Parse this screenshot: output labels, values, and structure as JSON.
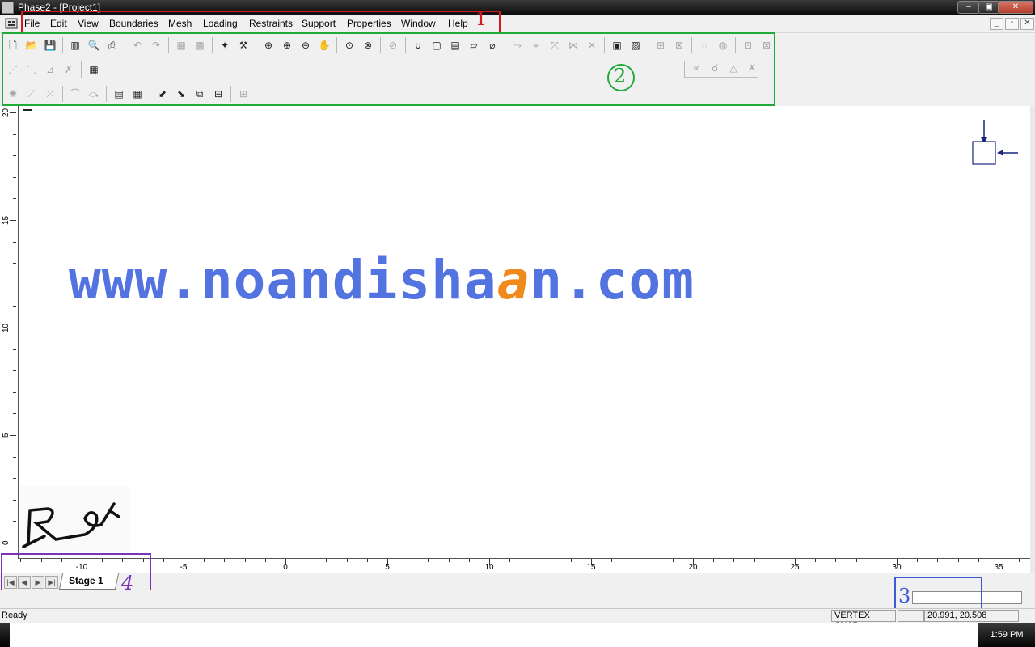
{
  "window": {
    "title": "Phase2 - [Project1]",
    "buttons": {
      "minimize": "–",
      "maximize": "▣",
      "close": "✕"
    }
  },
  "menu": {
    "items": [
      "File",
      "Edit",
      "View",
      "Boundaries",
      "Mesh",
      "Loading",
      "Restraints",
      "Support",
      "Properties",
      "Window",
      "Help"
    ],
    "mdi_buttons": {
      "minimize": "_",
      "restore": "▫",
      "close": "✕"
    }
  },
  "annotations": {
    "menu": "1",
    "toolbars": "2",
    "command_box": "3",
    "stage_tabs": "4"
  },
  "canvas": {
    "y_tick_labels": [
      "20",
      "15",
      "10",
      "5",
      "0"
    ],
    "x_tick_labels": [
      "-10",
      "-5",
      "0",
      "5",
      "10",
      "15",
      "20",
      "25",
      "30",
      "35"
    ],
    "watermark": {
      "before": "www.noandisha",
      "accent": "a",
      "after": "n.com"
    },
    "signature": "R"
  },
  "stages": {
    "nav": [
      "|◀",
      "◀",
      "▶",
      "▶|"
    ],
    "active_tab": "Stage 1"
  },
  "command_input": {
    "value": ""
  },
  "status": {
    "left": "Ready",
    "snap": "VERTEX SNAP",
    "coords": "20.991,  20.508"
  },
  "taskbar": {
    "clock": "1:59 PM"
  },
  "toolbar": {
    "row1": [
      "new-icon",
      "open-icon",
      "save-icon",
      "sep",
      "page-layout-icon",
      "print-preview-icon",
      "print-icon",
      "sep",
      "undo-icon",
      "redo-icon",
      "sep",
      "gray-box-icon",
      "gray-box-icon-2",
      "sep",
      "interpret-icon",
      "tools-icon",
      "sep",
      "zoom-all-icon",
      "zoom-in-icon",
      "zoom-out-icon",
      "pan-icon",
      "sep",
      "zoom-window-icon",
      "zoom-previous-icon",
      "sep",
      "zoom-extents-icon",
      "sep",
      "add-external-icon",
      "add-excavation-icon",
      "add-stage-boundary-icon",
      "add-material-boundary-icon",
      "delete-boundary-icon",
      "sep",
      "node-icon",
      "vertex-icon",
      "merge-icon",
      "mesh-icon",
      "discretize-icon",
      "sep",
      "mesh-setup-icon",
      "mesh-display-icon",
      "sep",
      "load-icon",
      "load-icon-2",
      "sep",
      "restraint-icon",
      "restraint-icon-2",
      "sep",
      "support-icon",
      "support-icon-2"
    ],
    "row2": [
      "bolt-icon",
      "bolt-icon-2",
      "bolt-icon-3",
      "bolt-icon-4",
      "sep",
      "liner-icon"
    ],
    "row2_right": [
      "pin-icon",
      "roller-icon",
      "triangle-icon",
      "free-icon"
    ],
    "row3": [
      "joint-icon",
      "line-icon",
      "line-icon-2",
      "sep",
      "curve-icon",
      "curve-icon-2",
      "sep",
      "query-icon",
      "query-icon-2",
      "sep",
      "material-assign-icon",
      "material-assign-icon-2",
      "material-assign-icon-3",
      "material-assign-icon-4",
      "sep",
      "properties-icon"
    ]
  },
  "colors": {
    "annot_1": "#d21c1c",
    "annot_2": "#1faa3a",
    "annot_3": "#3c5ad8",
    "annot_4": "#7a34b8",
    "watermark": "#5273e0",
    "watermark_accent": "#f08a1c"
  }
}
